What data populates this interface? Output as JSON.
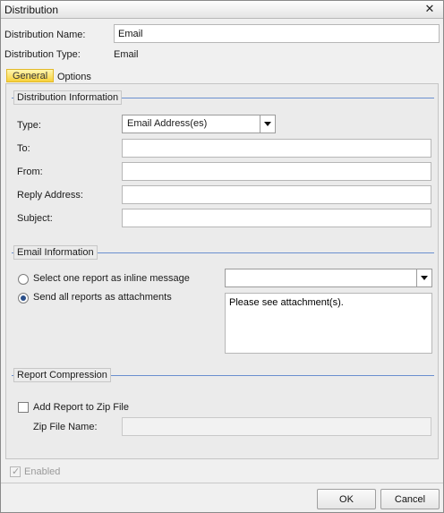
{
  "window": {
    "title": "Distribution"
  },
  "header": {
    "name_label": "Distribution Name:",
    "name_value": "Email",
    "type_label": "Distribution Type:",
    "type_value": "Email"
  },
  "tabs": [
    {
      "label": "General",
      "active": true
    },
    {
      "label": "Options",
      "active": false
    }
  ],
  "distribution_info": {
    "title": "Distribution Information",
    "type_label": "Type:",
    "type_value": "Email Address(es)",
    "to_label": "To:",
    "to_value": "",
    "from_label": "From:",
    "from_value": "",
    "reply_label": "Reply Address:",
    "reply_value": "",
    "subject_label": "Subject:",
    "subject_value": ""
  },
  "email_info": {
    "title": "Email Information",
    "option_inline": "Select one report as inline message",
    "option_attach": "Send all reports as attachments",
    "selected": "attach",
    "inline_select_value": "",
    "message": "Please see attachment(s)."
  },
  "compression": {
    "title": "Report Compression",
    "zip_label": "Add Report to Zip File",
    "zip_checked": false,
    "zip_name_label": "Zip File Name:",
    "zip_name_value": ""
  },
  "footer": {
    "enabled_label": "Enabled",
    "enabled_checked": true,
    "ok_label": "OK",
    "cancel_label": "Cancel"
  },
  "colors": {
    "accent_line": "#6a8fcf",
    "active_tab": "#f7d13a",
    "radio_dot": "#2a4f8a"
  },
  "icons": {
    "close": "close-icon",
    "dropdown": "chevron-down-icon",
    "radio": "radio-icon",
    "check": "checkmark-icon"
  }
}
